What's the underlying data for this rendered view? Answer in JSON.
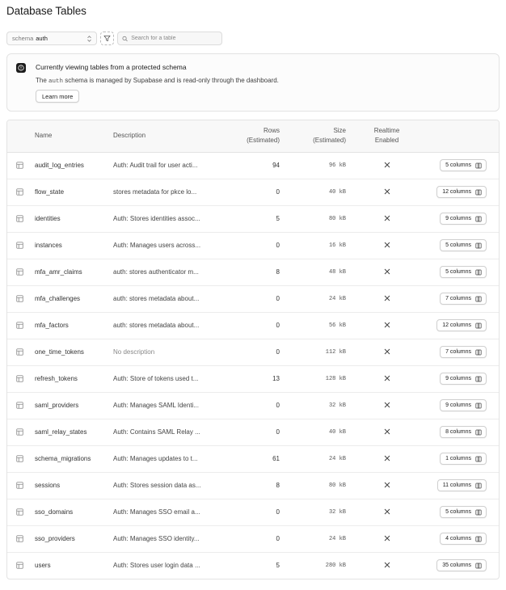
{
  "page": {
    "title": "Database Tables"
  },
  "toolbar": {
    "schema_label": "schema",
    "schema_value": "auth",
    "search_placeholder": "Search for a table"
  },
  "notice": {
    "title": "Currently viewing tables from a protected schema",
    "desc_prefix": "The",
    "desc_code": "auth",
    "desc_suffix": "schema is managed by Supabase and is read-only through the dashboard.",
    "learn_more": "Learn more"
  },
  "table": {
    "headers": {
      "name": "Name",
      "description": "Description",
      "rows_line1": "Rows",
      "rows_line2": "(Estimated)",
      "size_line1": "Size",
      "size_line2": "(Estimated)",
      "realtime_line1": "Realtime",
      "realtime_line2": "Enabled"
    },
    "realtime_icon": "x-icon",
    "rows": [
      {
        "name": "audit_log_entries",
        "description": "Auth: Audit trail for user acti...",
        "rows": "94",
        "size": "96 kB",
        "columns": "5 columns"
      },
      {
        "name": "flow_state",
        "description": "stores metadata for pkce lo...",
        "rows": "0",
        "size": "40 kB",
        "columns": "12 columns"
      },
      {
        "name": "identities",
        "description": "Auth: Stores identities assoc...",
        "rows": "5",
        "size": "80 kB",
        "columns": "9 columns"
      },
      {
        "name": "instances",
        "description": "Auth: Manages users across...",
        "rows": "0",
        "size": "16 kB",
        "columns": "5 columns"
      },
      {
        "name": "mfa_amr_claims",
        "description": "auth: stores authenticator m...",
        "rows": "8",
        "size": "48 kB",
        "columns": "5 columns"
      },
      {
        "name": "mfa_challenges",
        "description": "auth: stores metadata about...",
        "rows": "0",
        "size": "24 kB",
        "columns": "7 columns"
      },
      {
        "name": "mfa_factors",
        "description": "auth: stores metadata about...",
        "rows": "0",
        "size": "56 kB",
        "columns": "12 columns"
      },
      {
        "name": "one_time_tokens",
        "description": "No description",
        "rows": "0",
        "size": "112 kB",
        "columns": "7 columns",
        "muted": true
      },
      {
        "name": "refresh_tokens",
        "description": "Auth: Store of tokens used t...",
        "rows": "13",
        "size": "128 kB",
        "columns": "9 columns"
      },
      {
        "name": "saml_providers",
        "description": "Auth: Manages SAML Identi...",
        "rows": "0",
        "size": "32 kB",
        "columns": "9 columns"
      },
      {
        "name": "saml_relay_states",
        "description": "Auth: Contains SAML Relay ...",
        "rows": "0",
        "size": "40 kB",
        "columns": "8 columns"
      },
      {
        "name": "schema_migrations",
        "description": "Auth: Manages updates to t...",
        "rows": "61",
        "size": "24 kB",
        "columns": "1 columns"
      },
      {
        "name": "sessions",
        "description": "Auth: Stores session data as...",
        "rows": "8",
        "size": "80 kB",
        "columns": "11 columns"
      },
      {
        "name": "sso_domains",
        "description": "Auth: Manages SSO email a...",
        "rows": "0",
        "size": "32 kB",
        "columns": "5 columns"
      },
      {
        "name": "sso_providers",
        "description": "Auth: Manages SSO identity...",
        "rows": "0",
        "size": "24 kB",
        "columns": "4 columns"
      },
      {
        "name": "users",
        "description": "Auth: Stores user login data ...",
        "rows": "5",
        "size": "280 kB",
        "columns": "35 columns"
      }
    ]
  }
}
